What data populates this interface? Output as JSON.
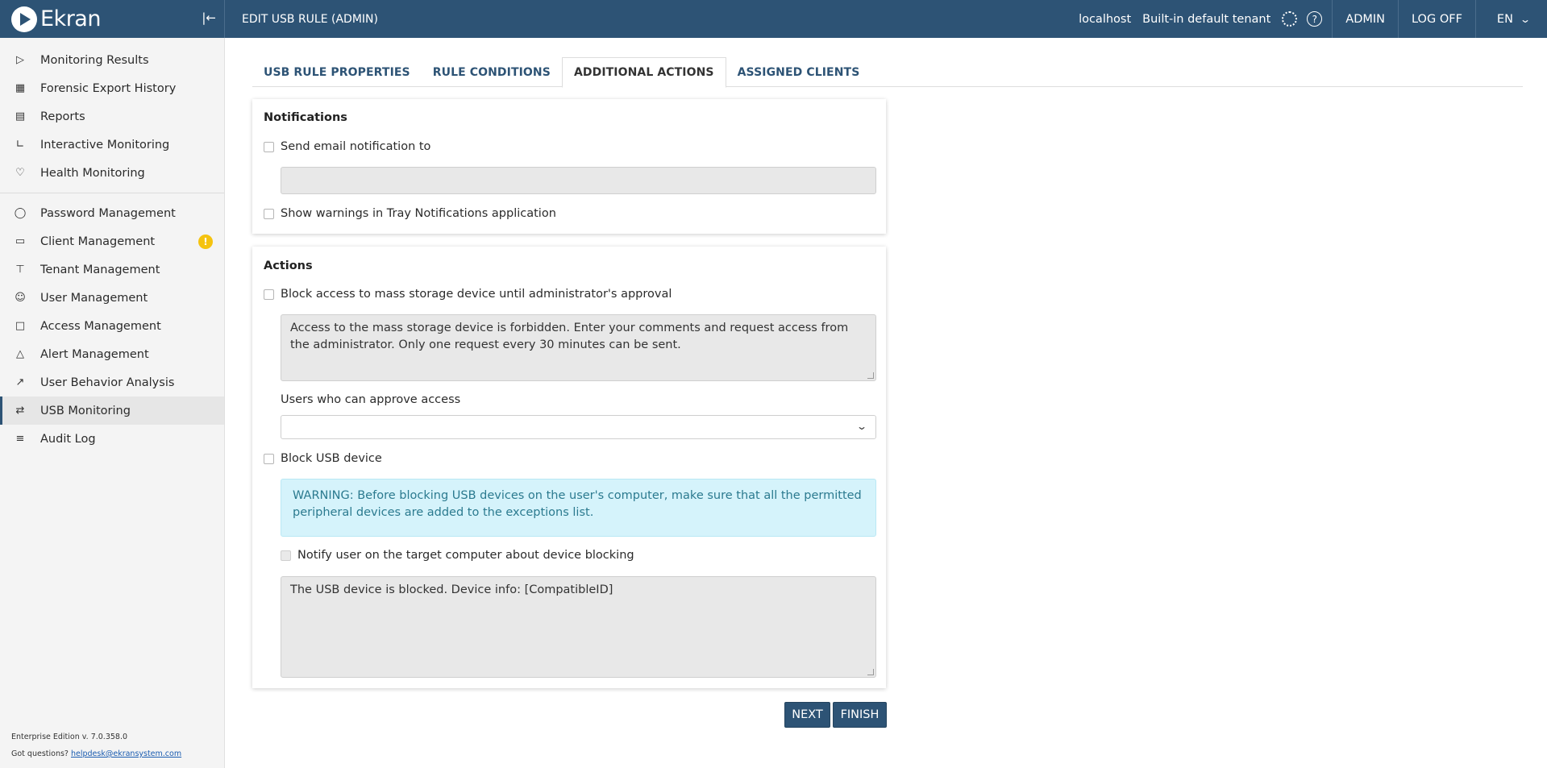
{
  "app": {
    "brand": "Ekran",
    "page_title": "EDIT USB RULE (ADMIN)"
  },
  "header": {
    "host": "localhost",
    "tenant": "Built-in default tenant",
    "user": "ADMIN",
    "logoff": "LOG OFF",
    "lang": "EN"
  },
  "sidebar": {
    "group1": [
      {
        "label": "Monitoring Results",
        "icon": "play-icon"
      },
      {
        "label": "Forensic Export History",
        "icon": "film-icon"
      },
      {
        "label": "Reports",
        "icon": "document-icon"
      },
      {
        "label": "Interactive Monitoring",
        "icon": "bar-chart-icon"
      },
      {
        "label": "Health Monitoring",
        "icon": "heart-icon"
      }
    ],
    "group2": [
      {
        "label": "Password Management",
        "icon": "shield-icon"
      },
      {
        "label": "Client Management",
        "icon": "monitor-icon",
        "badge": "!"
      },
      {
        "label": "Tenant Management",
        "icon": "hierarchy-icon"
      },
      {
        "label": "User Management",
        "icon": "user-icon"
      },
      {
        "label": "Access Management",
        "icon": "lock-icon"
      },
      {
        "label": "Alert Management",
        "icon": "bell-icon"
      },
      {
        "label": "User Behavior Analysis",
        "icon": "trend-icon"
      },
      {
        "label": "USB Monitoring",
        "icon": "usb-icon",
        "active": true
      },
      {
        "label": "Audit Log",
        "icon": "checklist-icon"
      }
    ],
    "footer": {
      "edition": "Enterprise Edition v. 7.0.358.0",
      "questions": "Got questions?",
      "email": "helpdesk@ekransystem.com"
    }
  },
  "tabs": [
    {
      "label": "USB RULE PROPERTIES"
    },
    {
      "label": "RULE CONDITIONS"
    },
    {
      "label": "ADDITIONAL ACTIONS",
      "active": true
    },
    {
      "label": "ASSIGNED CLIENTS"
    }
  ],
  "notifications": {
    "title": "Notifications",
    "send_email_label": "Send email notification to",
    "email_value": "",
    "tray_label": "Show warnings in Tray Notifications application"
  },
  "actions": {
    "title": "Actions",
    "block_mass_storage_label": "Block access to mass storage device until administrator's approval",
    "mass_storage_message": "Access to the mass storage device is forbidden. Enter your comments and request access from the administrator. Only one request every 30 minutes can be sent.",
    "approvers_label": "Users who can approve access",
    "approvers_value": "",
    "block_usb_label": "Block USB device",
    "warning_text": "WARNING: Before blocking USB devices on the user's computer, make sure that all the permitted peripheral devices are added to the exceptions list.",
    "notify_label": "Notify user on the target computer about device blocking",
    "notify_message": "The USB device is blocked. Device info: [CompatibleID]"
  },
  "buttons": {
    "next": "NEXT",
    "finish": "FINISH"
  }
}
